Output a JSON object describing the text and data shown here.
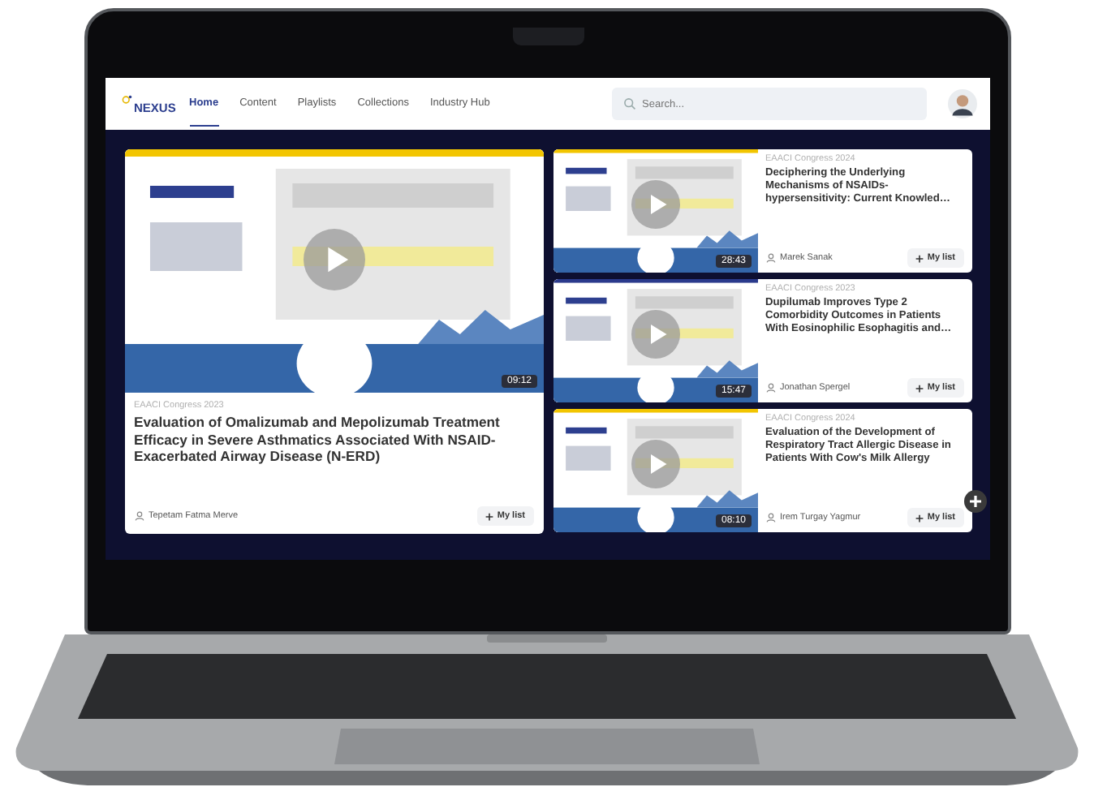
{
  "nav": {
    "logo": "NEXUS",
    "items": [
      {
        "label": "Home",
        "selected": true
      },
      {
        "label": "Content",
        "selected": false
      },
      {
        "label": "Playlists",
        "selected": false
      },
      {
        "label": "Collections",
        "selected": false
      },
      {
        "label": "Industry Hub",
        "selected": false
      }
    ],
    "search": {
      "placeholder": "Search..."
    }
  },
  "featured": {
    "event": "EAACI Congress 2023",
    "title": "Evaluation of Omalizumab and Mepolizumab Treatment Efficacy in Severe Asthmatics Associated With NSAID-Exacerbated Airway Disease (N-ERD)",
    "author": "Tepetam Fatma Merve",
    "duration": "09:12",
    "action": "My list"
  },
  "videos": [
    {
      "event": "EAACI Congress 2024",
      "title": "Deciphering the Underlying Mechanisms of NSAIDs-hypersensitivity: Current Knowled…",
      "author": "Marek Sanak",
      "duration": "28:43",
      "action": "My list"
    },
    {
      "event": "EAACI Congress 2023",
      "title": "Dupilumab Improves Type 2 Comorbidity Outcomes in Patients With Eosinophilic Esophagitis and…",
      "author": "Jonathan Spergel",
      "duration": "15:47",
      "action": "My list"
    },
    {
      "event": "EAACI Congress 2024",
      "title": "Evaluation of the Development of Respiratory Tract Allergic Disease in Patients With Cow's Milk Allergy",
      "author": "Irem Turgay Yagmur",
      "duration": "08:10",
      "action": "My list"
    }
  ]
}
